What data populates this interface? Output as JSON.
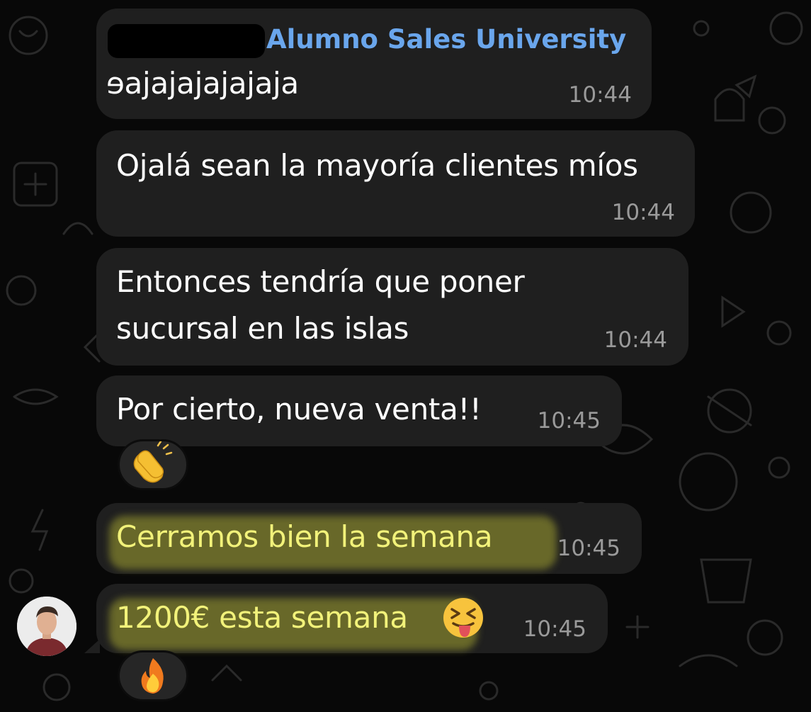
{
  "chat": {
    "sender_name": "Alumno Sales University",
    "messages": [
      {
        "text": "ɘajajajajajaja",
        "time": "10:44"
      },
      {
        "text": "Ojalá sean la mayoría clientes míos",
        "time": "10:44"
      },
      {
        "lines": [
          "Entonces tendría que poner",
          "sucursal en las islas"
        ],
        "time": "10:44"
      },
      {
        "text": "Por cierto, nueva venta!!",
        "time": "10:45",
        "reaction": "clapping-hands-emoji"
      },
      {
        "text": "Cerramos bien la semana",
        "time": "10:45",
        "highlighted": true
      },
      {
        "text": "1200€ esta semana",
        "time": "10:45",
        "emoji": "squinting-tongue-face-emoji",
        "reaction": "fire-emoji",
        "highlighted": true
      }
    ]
  },
  "colors": {
    "background": "#080808",
    "bubble": "#1f1f1f",
    "sender_name": "#6aa6ec",
    "timestamp": "#9a9a9a",
    "highlight": "#cece38"
  }
}
